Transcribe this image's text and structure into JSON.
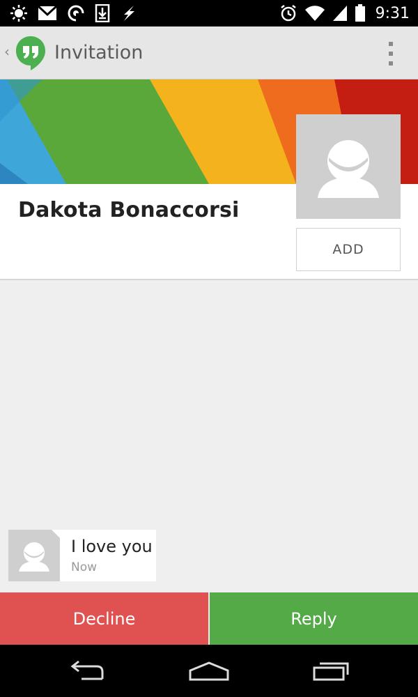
{
  "status_bar": {
    "time": "9:31",
    "left_icons": [
      "brightness-icon",
      "gmail-icon",
      "hangouts-status-icon",
      "download-icon",
      "flash-icon"
    ],
    "right_icons": [
      "alarm-icon",
      "wifi-icon",
      "signal-icon",
      "battery-icon"
    ]
  },
  "action_bar": {
    "title": "Invitation",
    "app_icon": "hangouts-logo-icon",
    "overflow_icon": "overflow-menu-icon"
  },
  "profile": {
    "name": "Dakota Bonaccorsi",
    "add_label": "ADD"
  },
  "message": {
    "text": "I love you",
    "time": "Now"
  },
  "actions": {
    "decline_label": "Decline",
    "reply_label": "Reply"
  },
  "colors": {
    "decline": "#e05252",
    "reply": "#55aa48",
    "hangouts_green": "#4caf50",
    "action_bar": "#e6e6e6"
  },
  "nav_bar": {
    "icons": [
      "back-icon",
      "home-icon",
      "recents-icon"
    ]
  }
}
